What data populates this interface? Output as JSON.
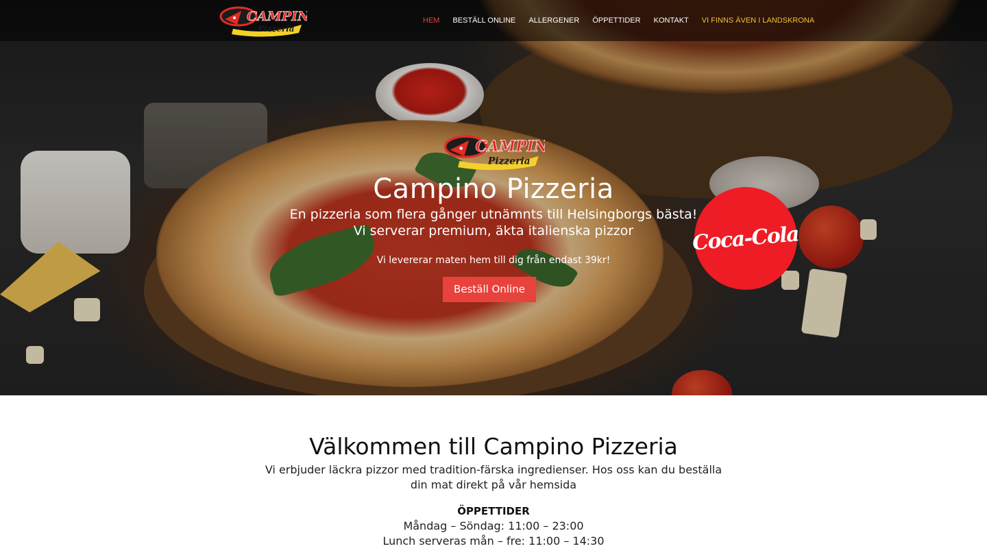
{
  "brand": {
    "name": "Campino Pizzeria",
    "logo_word_top": "CAMPINO",
    "logo_word_bottom": "Pizzeria",
    "logo_red": "#e32b25",
    "logo_yellow": "#f3d12a"
  },
  "nav": {
    "items": [
      {
        "label": "HEM",
        "active": true
      },
      {
        "label": "BESTÄLL ONLINE",
        "active": false
      },
      {
        "label": "ALLERGENER",
        "active": false
      },
      {
        "label": "ÖPPETTIDER",
        "active": false
      },
      {
        "label": "KONTAKT",
        "active": false
      },
      {
        "label": "VI FINNS ÄVEN I LANDSKRONA",
        "active": false
      }
    ],
    "active_color": "#e8423c",
    "highlight_color": "#f2c23a"
  },
  "hero": {
    "title": "Campino Pizzeria",
    "subtitle_line1": "En pizzeria som flera gånger utnämnts till Helsingborgs bästa!",
    "subtitle_line2": "Vi serverar premium, äkta italienska pizzor",
    "delivery_text": "Vi levererar maten hem till dig från endast 39kr!",
    "order_button": "Beställ Online",
    "button_color": "#e8423c"
  },
  "partner_badge": {
    "text": "Coca-Cola",
    "color": "#ee1c25"
  },
  "welcome": {
    "title": "Välkommen till Campino Pizzeria",
    "text": "Vi erbjuder läckra pizzor med tradition-färska ingredienser. Hos oss kan du beställa din mat direkt på vår hemsida",
    "hours_heading": "ÖPPETTIDER",
    "hours_line1": "Måndag – Söndag: 11:00 – 23:00",
    "hours_line2": "Lunch serveras mån – fre: 11:00 – 14:30"
  }
}
